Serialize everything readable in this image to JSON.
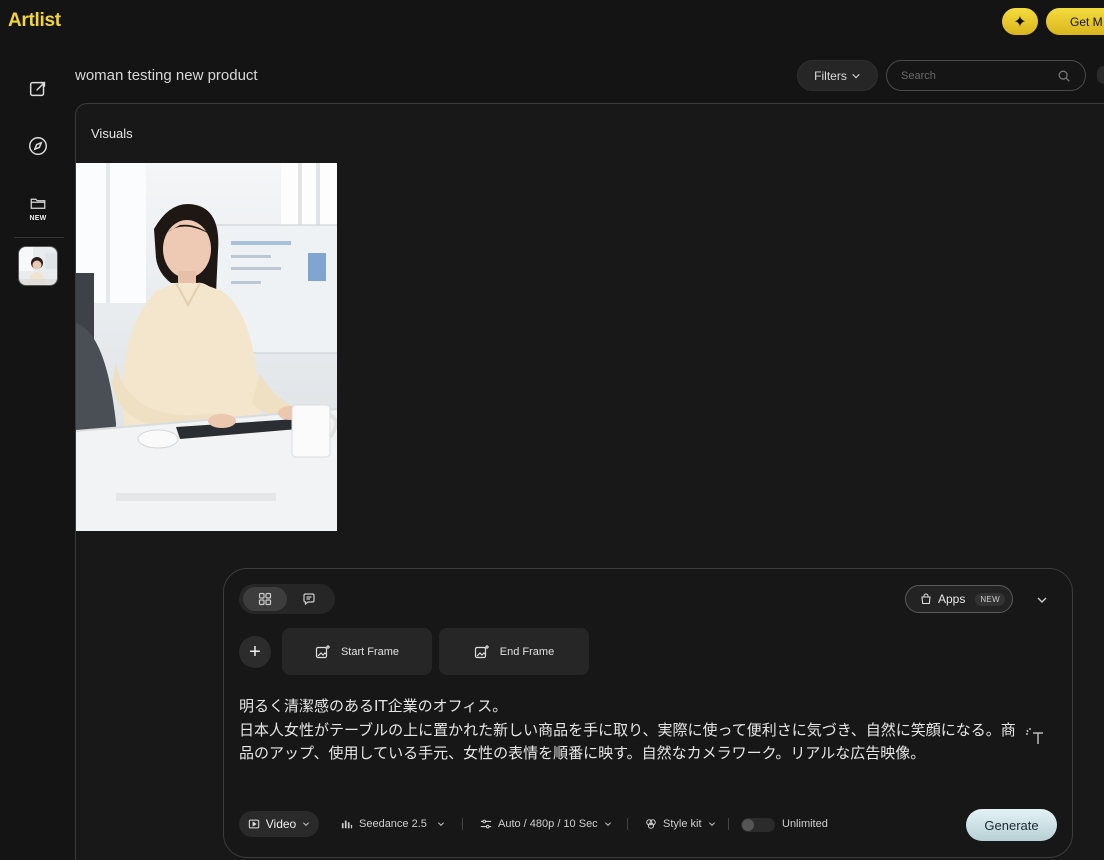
{
  "app": {
    "logo": "Artlist"
  },
  "topbar": {
    "get_more_label": "Get M",
    "star_icon": "sparkle-icon",
    "accent": "#f3d43a"
  },
  "sidebar": {
    "items": [
      {
        "icon": "edit-icon"
      },
      {
        "icon": "compass-icon"
      },
      {
        "icon": "folder-icon",
        "badge": "NEW"
      }
    ]
  },
  "header": {
    "title": "woman testing new product",
    "filters_label": "Filters",
    "search_placeholder": "Search"
  },
  "main": {
    "section_label": "Visuals"
  },
  "composer": {
    "apps_label": "Apps",
    "apps_badge": "NEW",
    "start_frame_label": "Start Frame",
    "end_frame_label": "End Frame",
    "prompt_text": "明るく清潔感のあるIT企業のオフィス。\n日本人女性がテーブルの上に置かれた新しい商品を手に取り、実際に使って便利さに気づき、自然に笑顔になる。商品のアップ、使用している手元、女性の表情を順番に映す。自然なカメラワーク。リアルな広告映像。",
    "video_label": "Video",
    "model_label": "Seedance 2.5",
    "settings_label": "Auto / 480p / 10 Sec",
    "style_kit_label": "Style kit",
    "unlimited_label": "Unlimited",
    "unlimited_on": false,
    "generate_label": "Generate"
  }
}
